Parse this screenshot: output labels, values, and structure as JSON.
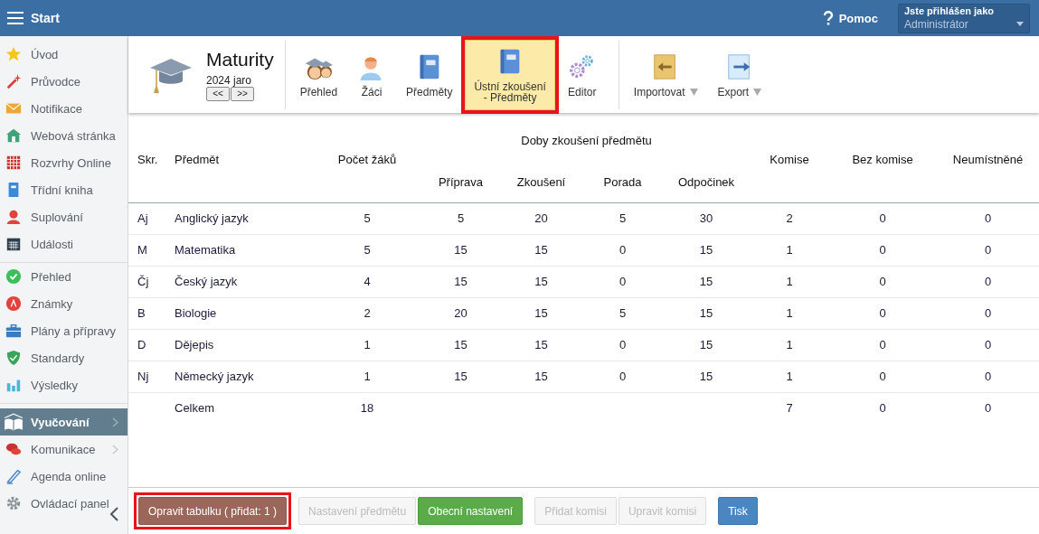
{
  "topbar": {
    "title": "Start",
    "help": "Pomoc",
    "user_caption": "Jste přihlášen jako",
    "user_name": "Administrátor"
  },
  "sidebar": {
    "groups": [
      {
        "items": [
          {
            "label": "Úvod",
            "kind": "star",
            "selected": false,
            "submenu": false
          },
          {
            "label": "Průvodce",
            "kind": "wand",
            "selected": false,
            "submenu": false
          },
          {
            "label": "Notifikace",
            "kind": "envelope",
            "selected": false,
            "submenu": false
          },
          {
            "label": "Webová stránka",
            "kind": "house",
            "selected": false,
            "submenu": false
          },
          {
            "label": "Rozvrhy Online",
            "kind": "timetable",
            "selected": false,
            "submenu": false
          },
          {
            "label": "Třídní kniha",
            "kind": "notebook",
            "selected": false,
            "submenu": false
          },
          {
            "label": "Suplování",
            "kind": "person",
            "selected": false,
            "submenu": false
          },
          {
            "label": "Události",
            "kind": "calendar",
            "selected": false,
            "submenu": false
          }
        ]
      },
      {
        "items": [
          {
            "label": "Přehled",
            "kind": "check",
            "selected": false,
            "submenu": false
          },
          {
            "label": "Známky",
            "kind": "grade",
            "selected": false,
            "submenu": false
          },
          {
            "label": "Plány a přípravy",
            "kind": "briefcase",
            "selected": false,
            "submenu": false
          },
          {
            "label": "Standardy",
            "kind": "shield",
            "selected": false,
            "submenu": false
          },
          {
            "label": "Výsledky",
            "kind": "chart",
            "selected": false,
            "submenu": false
          }
        ]
      },
      {
        "items": [
          {
            "label": "Vyučování",
            "kind": "openbook",
            "selected": true,
            "submenu": true
          },
          {
            "label": "Komunikace",
            "kind": "chat",
            "selected": false,
            "submenu": true
          },
          {
            "label": "Agenda online",
            "kind": "pen",
            "selected": false,
            "submenu": false
          },
          {
            "label": "Ovládací panel",
            "kind": "gear",
            "selected": false,
            "submenu": false
          }
        ]
      }
    ]
  },
  "module": {
    "title": "Maturity",
    "period": "2024 jaro",
    "nav": [
      "<<",
      ">>"
    ]
  },
  "toolbar": {
    "groups": [
      {
        "items": [
          {
            "label": "Přehled",
            "kind": "graduates",
            "selected": false,
            "menu": false
          },
          {
            "label": "Žáci",
            "kind": "student",
            "selected": false,
            "menu": false
          },
          {
            "label": "Předměty",
            "kind": "book",
            "selected": false,
            "menu": false
          },
          {
            "label": "Ústní zkoušení\n- Předměty",
            "kind": "book",
            "selected": true,
            "menu": false
          },
          {
            "label": "Editor",
            "kind": "gears",
            "selected": false,
            "menu": false
          }
        ]
      },
      {
        "items": [
          {
            "label": "Importovat",
            "kind": "import",
            "selected": false,
            "menu": true
          },
          {
            "label": "Export",
            "kind": "export",
            "selected": false,
            "menu": true
          }
        ]
      }
    ]
  },
  "table": {
    "group_header": "Doby zkoušení předmětu",
    "columns": [
      {
        "label": "Skr.",
        "group": false
      },
      {
        "label": "Předmět",
        "group": false
      },
      {
        "label": "Počet žáků",
        "group": false
      },
      {
        "label": "Příprava",
        "group": true
      },
      {
        "label": "Zkoušení",
        "group": true
      },
      {
        "label": "Porada",
        "group": true
      },
      {
        "label": "Odpočinek",
        "group": true
      },
      {
        "label": "Komise",
        "group": false
      },
      {
        "label": "Bez komise",
        "group": false
      },
      {
        "label": "Neumístněné",
        "group": false
      }
    ],
    "rows": [
      [
        "Aj",
        "Anglický jazyk",
        "5",
        "5",
        "20",
        "5",
        "30",
        "2",
        "0",
        "0"
      ],
      [
        "M",
        "Matematika",
        "5",
        "15",
        "15",
        "0",
        "15",
        "1",
        "0",
        "0"
      ],
      [
        "Čj",
        "Český jazyk",
        "4",
        "15",
        "15",
        "0",
        "15",
        "1",
        "0",
        "0"
      ],
      [
        "B",
        "Biologie",
        "2",
        "20",
        "15",
        "5",
        "15",
        "1",
        "0",
        "0"
      ],
      [
        "D",
        "Dějepis",
        "1",
        "15",
        "15",
        "0",
        "15",
        "1",
        "0",
        "0"
      ],
      [
        "Nj",
        "Německý jazyk",
        "1",
        "15",
        "15",
        "0",
        "15",
        "1",
        "0",
        "0"
      ]
    ],
    "total": {
      "label": "Celkem",
      "count": "18",
      "komise": "7",
      "bez_komise": "0",
      "neumistnene": "0"
    }
  },
  "actions": {
    "groups": [
      {
        "buttons": [
          {
            "label": "Opravit tabulku ( přidat: 1 )",
            "kind": "danger",
            "disabled": false,
            "highlighted": true
          }
        ]
      },
      {
        "buttons": [
          {
            "label": "Nastavení předmětu",
            "kind": "default",
            "disabled": true,
            "highlighted": false
          },
          {
            "label": "Obecní nastavení",
            "kind": "success",
            "disabled": false,
            "highlighted": false
          }
        ]
      },
      {
        "buttons": [
          {
            "label": "Přidat komisi",
            "kind": "default",
            "disabled": true,
            "highlighted": false
          },
          {
            "label": "Upravit komisi",
            "kind": "default",
            "disabled": true,
            "highlighted": false
          }
        ]
      },
      {
        "buttons": [
          {
            "label": "Tisk",
            "kind": "primary",
            "disabled": false,
            "highlighted": false
          }
        ]
      }
    ]
  }
}
